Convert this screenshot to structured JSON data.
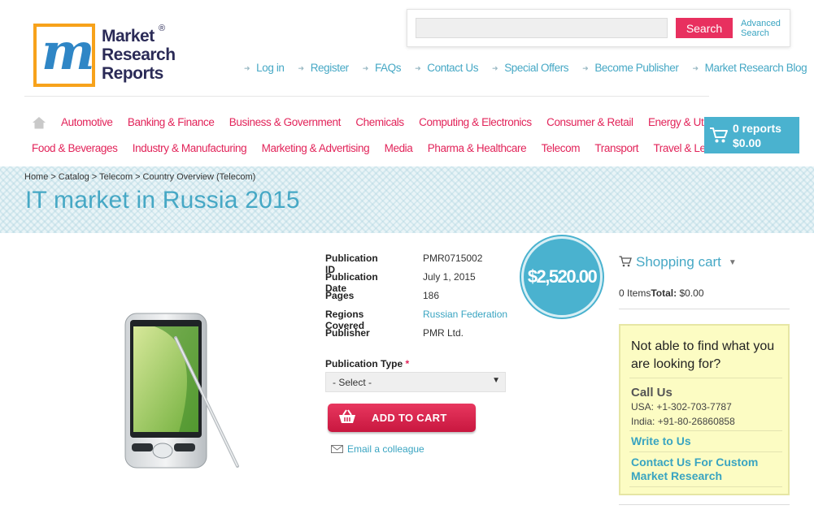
{
  "logo": {
    "lines": [
      "Market",
      "Research",
      "Reports"
    ],
    "registered": "®"
  },
  "search": {
    "placeholder": "",
    "button_label": "Search",
    "advanced_label": "Advanced Search"
  },
  "top_links": [
    "Log in",
    "Register",
    "FAQs",
    "Contact Us",
    "Special Offers",
    "Become Publisher",
    "Market Research Blog"
  ],
  "categories_row1": [
    "Automotive",
    "Banking & Finance",
    "Business & Government",
    "Chemicals",
    "Computing & Electronics",
    "Consumer & Retail",
    "Energy & Utilities"
  ],
  "categories_row2": [
    "Food & Beverages",
    "Industry & Manufacturing",
    "Marketing & Advertising",
    "Media",
    "Pharma & Healthcare",
    "Telecom",
    "Transport",
    "Travel & Leisure"
  ],
  "mini_cart": {
    "reports": "0 reports",
    "total": "$0.00"
  },
  "breadcrumb": [
    "Home",
    "Catalog",
    "Telecom",
    "Country Overview (Telecom)"
  ],
  "page_title": "IT market in Russia 2015",
  "details": [
    {
      "key": "Publication ID",
      "value": "PMR0715002"
    },
    {
      "key": "Publication Date",
      "value": "July 1, 2015"
    },
    {
      "key": "Pages",
      "value": "186"
    },
    {
      "key": "Regions Covered",
      "value": "Russian Federation"
    },
    {
      "key": "Publisher",
      "value": "PMR Ltd."
    }
  ],
  "price": "$2,520.00",
  "publication_type": {
    "label": "Publication Type",
    "required_mark": "*",
    "selected": "- Select -"
  },
  "add_to_cart_label": "ADD TO CART",
  "email_colleague_label": "Email a colleague",
  "shopping_cart": {
    "title": "Shopping cart",
    "items": "0 Items",
    "total_label": "Total:",
    "total_value": "$0.00"
  },
  "help_box": {
    "question": "Not able to find what you are looking for?",
    "call_us_title": "Call Us",
    "usa": "USA: +1-302-703-7787",
    "india": "India: +91-80-26860858",
    "write_to_us": "Write to Us",
    "contact_custom": "Contact Us For Custom Market Research"
  },
  "colors": {
    "accent": "#46a8c5",
    "category": "#e2245a",
    "search_button": "#e8305f",
    "cart_bg": "#4ab2cf",
    "logo_border": "#f7a21b",
    "help_bg": "#fcfcc3"
  }
}
